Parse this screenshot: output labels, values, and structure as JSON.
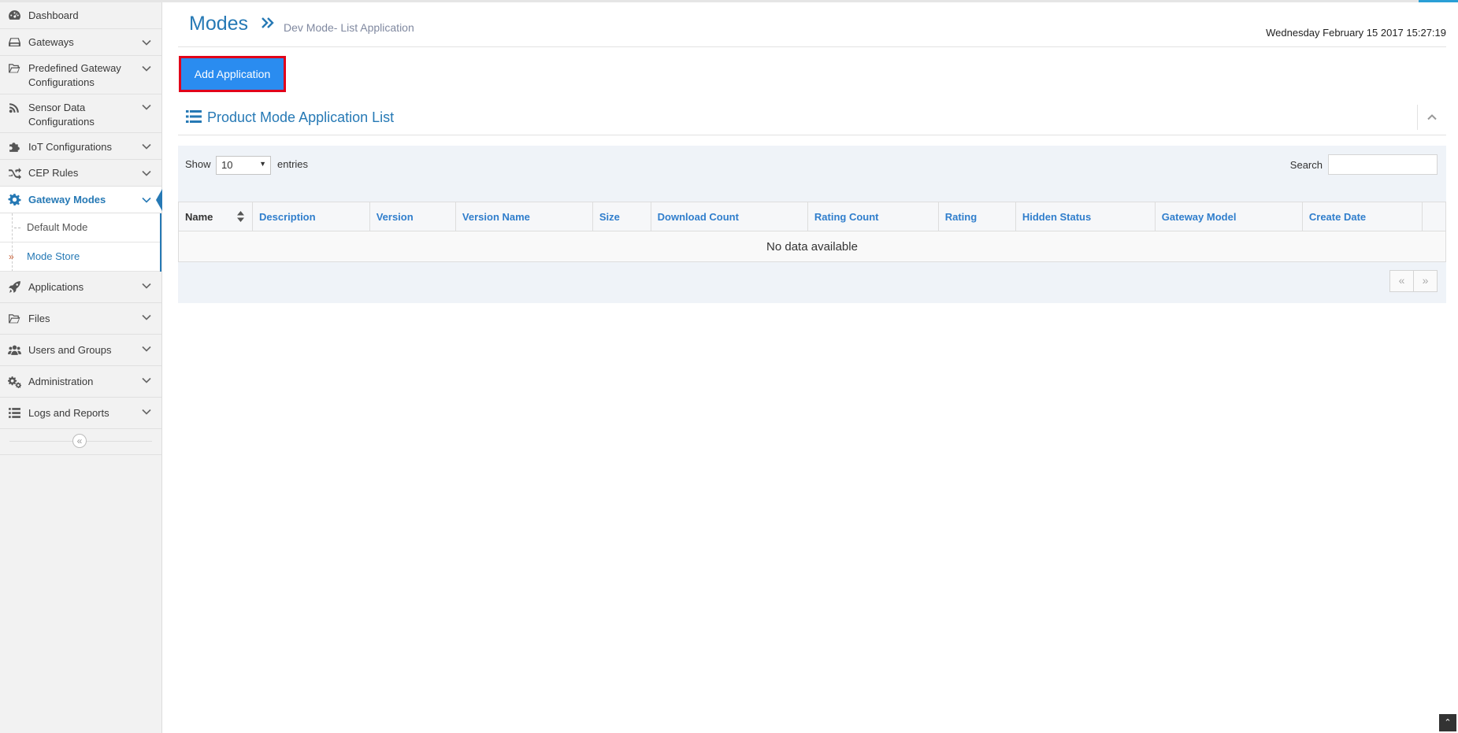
{
  "sidebar": {
    "items": [
      {
        "label": "Dashboard",
        "icon": "dashboard-icon"
      },
      {
        "label": "Gateways",
        "icon": "hdd-icon"
      },
      {
        "label": "Predefined Gateway Configurations",
        "icon": "folder-open-icon"
      },
      {
        "label": "Sensor Data Configurations",
        "icon": "rss-icon"
      },
      {
        "label": "IoT Configurations",
        "icon": "puzzle-icon"
      },
      {
        "label": "CEP Rules",
        "icon": "random-icon"
      },
      {
        "label": "Gateway Modes",
        "icon": "gear-icon"
      },
      {
        "label": "Applications",
        "icon": "rocket-icon"
      },
      {
        "label": "Files",
        "icon": "folder-open-icon"
      },
      {
        "label": "Users and Groups",
        "icon": "users-icon"
      },
      {
        "label": "Administration",
        "icon": "gears-icon"
      },
      {
        "label": "Logs and Reports",
        "icon": "list-icon"
      }
    ],
    "submenu": [
      {
        "label": "Default Mode"
      },
      {
        "label": "Mode Store"
      }
    ]
  },
  "header": {
    "title": "Modes",
    "subtitle": "Dev Mode- List Application",
    "date": "Wednesday February 15 2017 15:27:19"
  },
  "toolbar": {
    "add_label": "Add Application"
  },
  "widget": {
    "title": "Product Mode Application List"
  },
  "table": {
    "show_label": "Show",
    "entries_value": "10",
    "entries_label": "entries",
    "search_label": "Search",
    "search_value": "",
    "columns": [
      "Name",
      "Description",
      "Version",
      "Version Name",
      "Size",
      "Download Count",
      "Rating Count",
      "Rating",
      "Hidden Status",
      "Gateway Model",
      "Create Date"
    ],
    "empty_text": "No data available"
  },
  "pager": {
    "prev": "«",
    "next": "»"
  },
  "colors": {
    "accent": "#2679b5",
    "button": "#2a8cf0",
    "highlight": "#e1001a"
  }
}
